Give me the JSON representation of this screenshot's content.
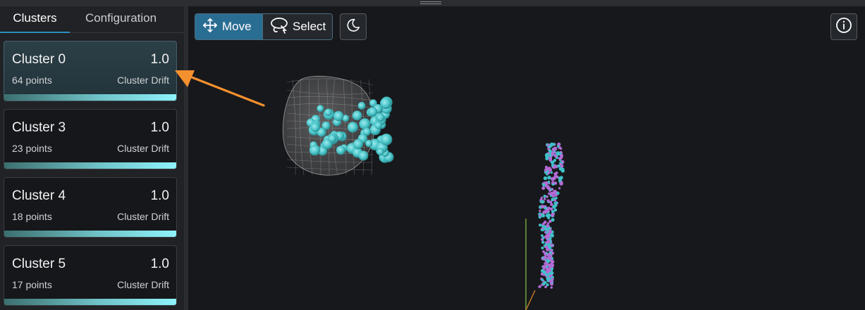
{
  "tabs": [
    {
      "label": "Clusters",
      "active": true
    },
    {
      "label": "Configuration",
      "active": false
    }
  ],
  "clusters": [
    {
      "name": "Cluster 0",
      "value": "1.0",
      "points": "64 points",
      "type": "Cluster Drift",
      "selected": true,
      "drift_fraction": 1.0
    },
    {
      "name": "Cluster 3",
      "value": "1.0",
      "points": "23 points",
      "type": "Cluster Drift",
      "selected": false,
      "drift_fraction": 1.0
    },
    {
      "name": "Cluster 4",
      "value": "1.0",
      "points": "18 points",
      "type": "Cluster Drift",
      "selected": false,
      "drift_fraction": 1.0
    },
    {
      "name": "Cluster 5",
      "value": "1.0",
      "points": "17 points",
      "type": "Cluster Drift",
      "selected": false,
      "drift_fraction": 1.0
    }
  ],
  "toolbar": {
    "move_label": "Move",
    "select_label": "Select",
    "move_icon": "move-arrows-icon",
    "select_icon": "lasso-icon",
    "theme_icon": "moon-icon",
    "info_icon": "info-icon"
  },
  "colors": {
    "accent": "#2a6d92",
    "cluster_points": "#4fd1d4",
    "drift_points_a": "#b36bd6",
    "drift_points_b": "#3fc0c8",
    "annotation_arrow": "#f5902f",
    "bar_end": "#8ef3fb"
  }
}
